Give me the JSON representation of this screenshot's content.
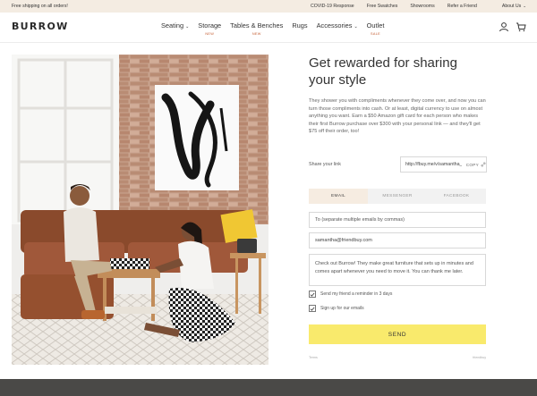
{
  "announcement": {
    "promo": "Free shipping on all orders!",
    "links": [
      "COVID-19 Response",
      "Free Swatches",
      "Showrooms",
      "Refer a Friend"
    ],
    "account": "About Us"
  },
  "header": {
    "logo": "BURROW",
    "nav": [
      {
        "label": "Seating",
        "has_menu": true,
        "badge": ""
      },
      {
        "label": "Storage",
        "has_menu": false,
        "badge": "NEW"
      },
      {
        "label": "Tables & Benches",
        "has_menu": false,
        "badge": "NEW"
      },
      {
        "label": "Rugs",
        "has_menu": false,
        "badge": ""
      },
      {
        "label": "Accessories",
        "has_menu": true,
        "badge": ""
      },
      {
        "label": "Outlet",
        "has_menu": false,
        "badge": "SALE"
      }
    ],
    "icons": [
      "user-icon",
      "cart-icon"
    ]
  },
  "referral": {
    "title": "Get rewarded for sharing your style",
    "description": "They shower you with compliments whenever they come over, and now you can turn those compliments into cash. Or at least, digital currency to use on almost anything you want. Earn a $50 Amazon gift card for each person who makes their first Burrow purchase over $300 with your personal link — and they'll get $75 off their order, too!",
    "share_label": "Share your link",
    "share_url": "http://fbuy.me/v/samantha_7107",
    "copy_label": "COPY",
    "tabs": [
      {
        "label": "EMAIL",
        "active": true
      },
      {
        "label": "MESSENGER",
        "active": false
      },
      {
        "label": "FACEBOOK",
        "active": false
      }
    ],
    "to_placeholder": "To (separate multiple emails by commas)",
    "from_value": "samantha@friendbuy.com",
    "message": "Check out Burrow! They make great furniture that sets up in minutes and comes apart whenever you need to move it. You can thank me later.",
    "check_reminder": "Send my friend a reminder in 3 days",
    "check_emails": "Sign up for our emails",
    "reminder_checked": true,
    "emails_checked": true,
    "send_label": "SEND",
    "footer_left": "Terms",
    "footer_right": "friendbuy"
  },
  "colors": {
    "announcement_bg": "#f4ece2",
    "accent_badge": "#c35b2f",
    "send_button": "#f9ea6c",
    "active_tab": "#f6ece1",
    "footer_band": "#4a4947"
  }
}
